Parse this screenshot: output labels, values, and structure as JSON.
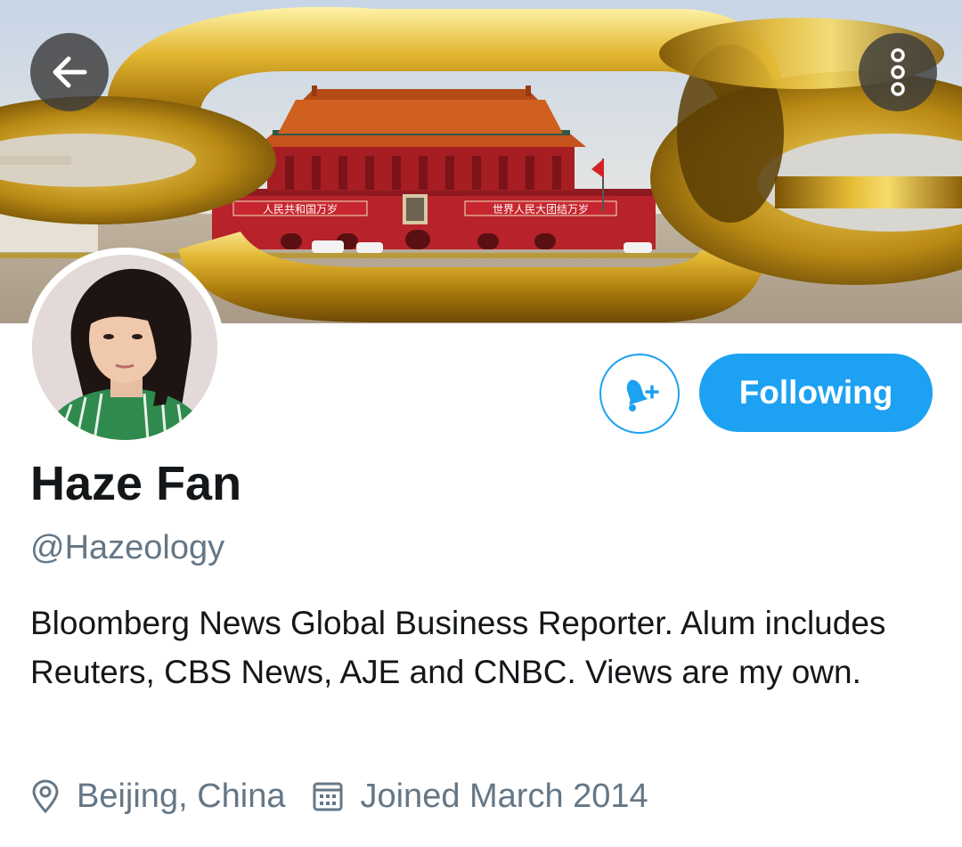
{
  "profile": {
    "display_name": "Haze Fan",
    "handle": "@Hazeology",
    "bio": "Bloomberg News Global Business Reporter. Alum includes Reuters, CBS News, AJE and CNBC. Views are my own.",
    "location": "Beijing, China",
    "joined": "Joined March 2014"
  },
  "actions": {
    "following_label": "Following"
  },
  "banner": {
    "sign_left": "人民共和国万岁",
    "sign_right": "世界人民大团结万岁"
  },
  "icons": {
    "back": "arrow-left-icon",
    "more": "more-vertical-icon",
    "notify": "bell-plus-icon",
    "location": "location-pin-icon",
    "calendar": "calendar-icon"
  },
  "colors": {
    "accent": "#1da1f2",
    "text_primary": "#14171a",
    "text_secondary": "#657786",
    "overlay_button": "#3c3c3c"
  }
}
